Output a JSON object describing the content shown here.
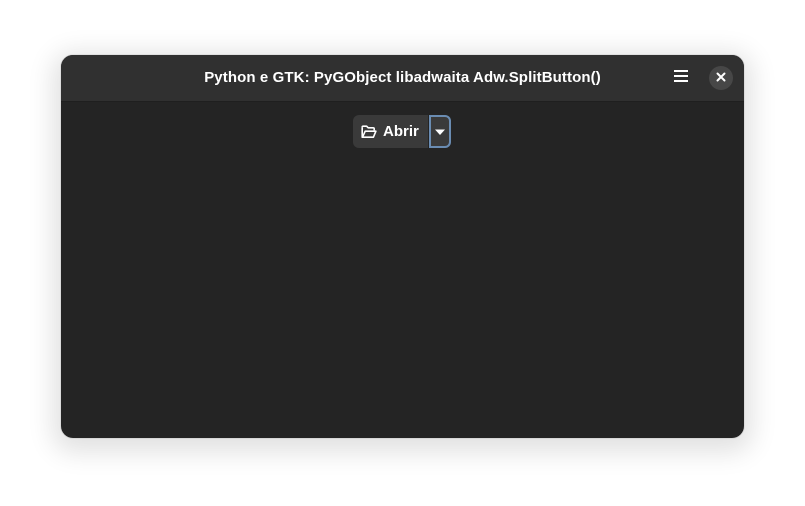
{
  "window": {
    "title": "Python e GTK: PyGObject libadwaita Adw.SplitButton()"
  },
  "headerbar": {
    "menu_icon": "hamburger-menu-icon",
    "close_icon": "close-icon"
  },
  "split_button": {
    "label": "Abrir",
    "icon": "folder-open-icon",
    "dropdown_icon": "pan-down-icon",
    "focus_color": "#6a8cb2"
  },
  "colors": {
    "window_bg": "#242424",
    "headerbar_bg": "#303030",
    "button_bg": "#3a3a3a"
  }
}
